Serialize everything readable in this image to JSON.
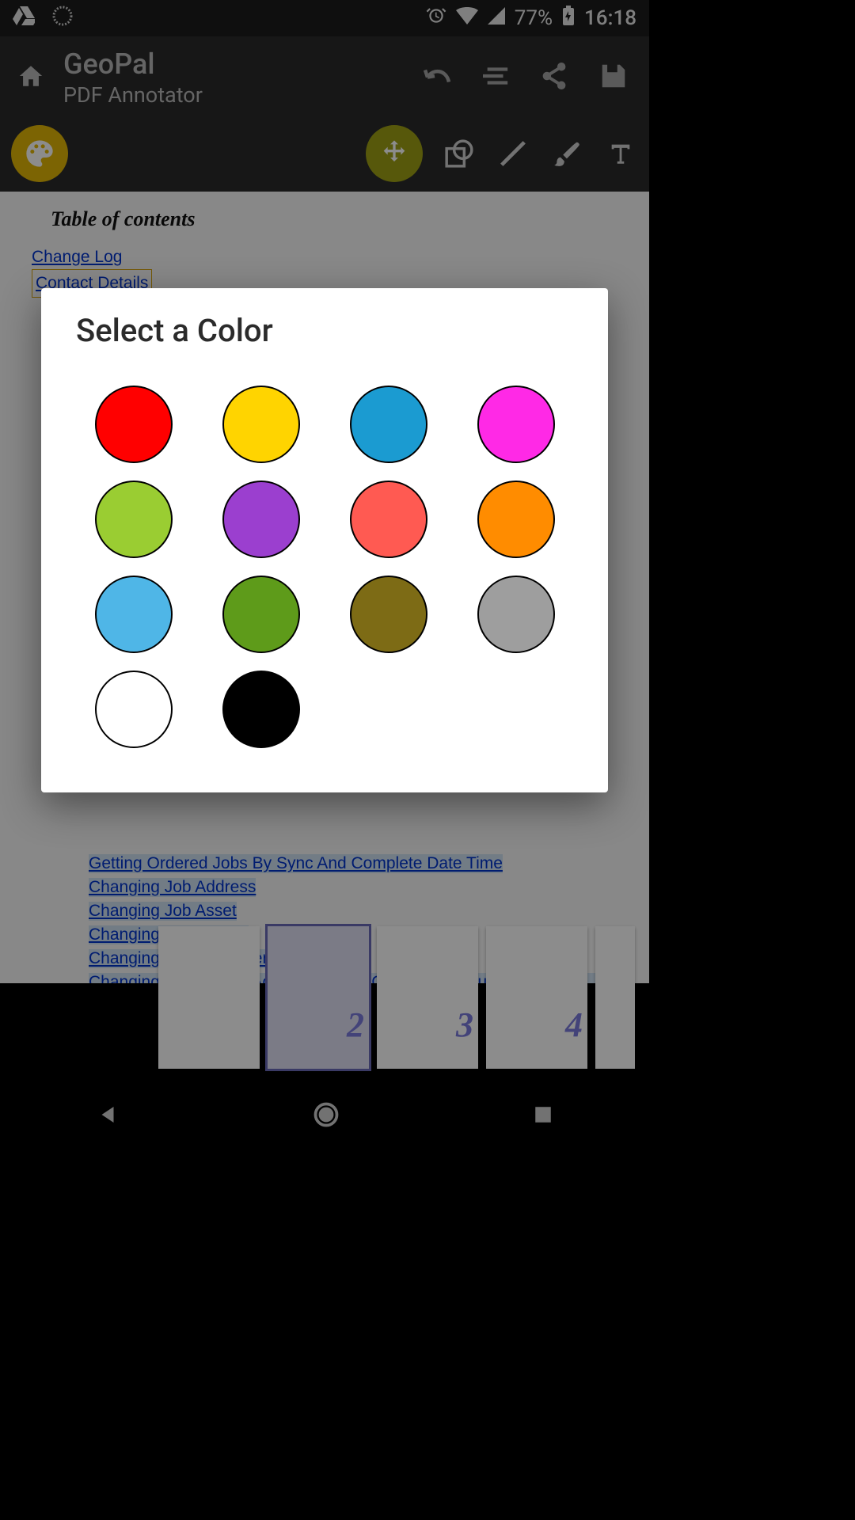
{
  "statusbar": {
    "battery": "77%",
    "time": "16:18"
  },
  "app": {
    "title": "GeoPal",
    "subtitle": "PDF Annotator"
  },
  "dialog": {
    "title": "Select a Color",
    "colors": [
      "#ff0000",
      "#ffd400",
      "#1b9bd1",
      "#ff29e6",
      "#9acd32",
      "#9b3fcf",
      "#ff5a52",
      "#ff8c00",
      "#4fb6e7",
      "#5e9b1a",
      "#7d6b15",
      "#9e9e9e",
      "#ffffff",
      "#000000"
    ]
  },
  "content": {
    "tocTitle": "Table of contents",
    "links": {
      "changeLog": "Change Log",
      "contactDetails": "Contact Details",
      "gettingOrdered": "Getting Ordered Jobs By Sync And Complete Date Time",
      "changingAddress": "Changing Job Address",
      "changingAsset": "Changing Job Asset",
      "changingPerson": "Changing Job Person",
      "changingCustomer": "Changing Job Customer",
      "changingAll": "Changing Job Status, Address, Asset, Contact and Customer at the same time"
    }
  },
  "thumbs": {
    "p2": "2",
    "p3": "3",
    "p4": "4"
  }
}
